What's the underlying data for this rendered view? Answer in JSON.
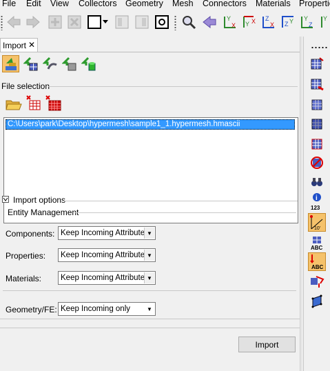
{
  "menu": [
    "File",
    "Edit",
    "View",
    "Collectors",
    "Geometry",
    "Mesh",
    "Connectors",
    "Materials",
    "Properties"
  ],
  "tab": {
    "label": "Import",
    "close": "✕"
  },
  "sections": {
    "file_selection": "File selection",
    "import_options": "Import options",
    "entity_management": "Entity Management"
  },
  "file_list": [
    "C:\\Users\\park\\Desktop\\hypermesh\\sample1_1.hypermesh.hmascii"
  ],
  "options": {
    "components": {
      "label": "Components:",
      "value": "Keep Incoming Attributes"
    },
    "properties": {
      "label": "Properties:",
      "value": "Keep Incoming Attributes"
    },
    "materials": {
      "label": "Materials:",
      "value": "Keep Incoming Attributes"
    },
    "geometry_fe": {
      "label": "Geometry/FE:",
      "value": "Keep Incoming only"
    }
  },
  "import_button": "Import",
  "right_text": {
    "num": "123",
    "abc1": "ABC",
    "abc2": "ABC",
    "dim": "10'"
  },
  "axis_labels": [
    "Y",
    "X",
    "Y",
    "X",
    "Z",
    "X",
    "Z",
    "Y",
    "Y",
    "Z"
  ],
  "colors": {
    "selection": "#3399ff",
    "panel": "#f0f0f0",
    "accent_orange": "#f5c26b"
  }
}
